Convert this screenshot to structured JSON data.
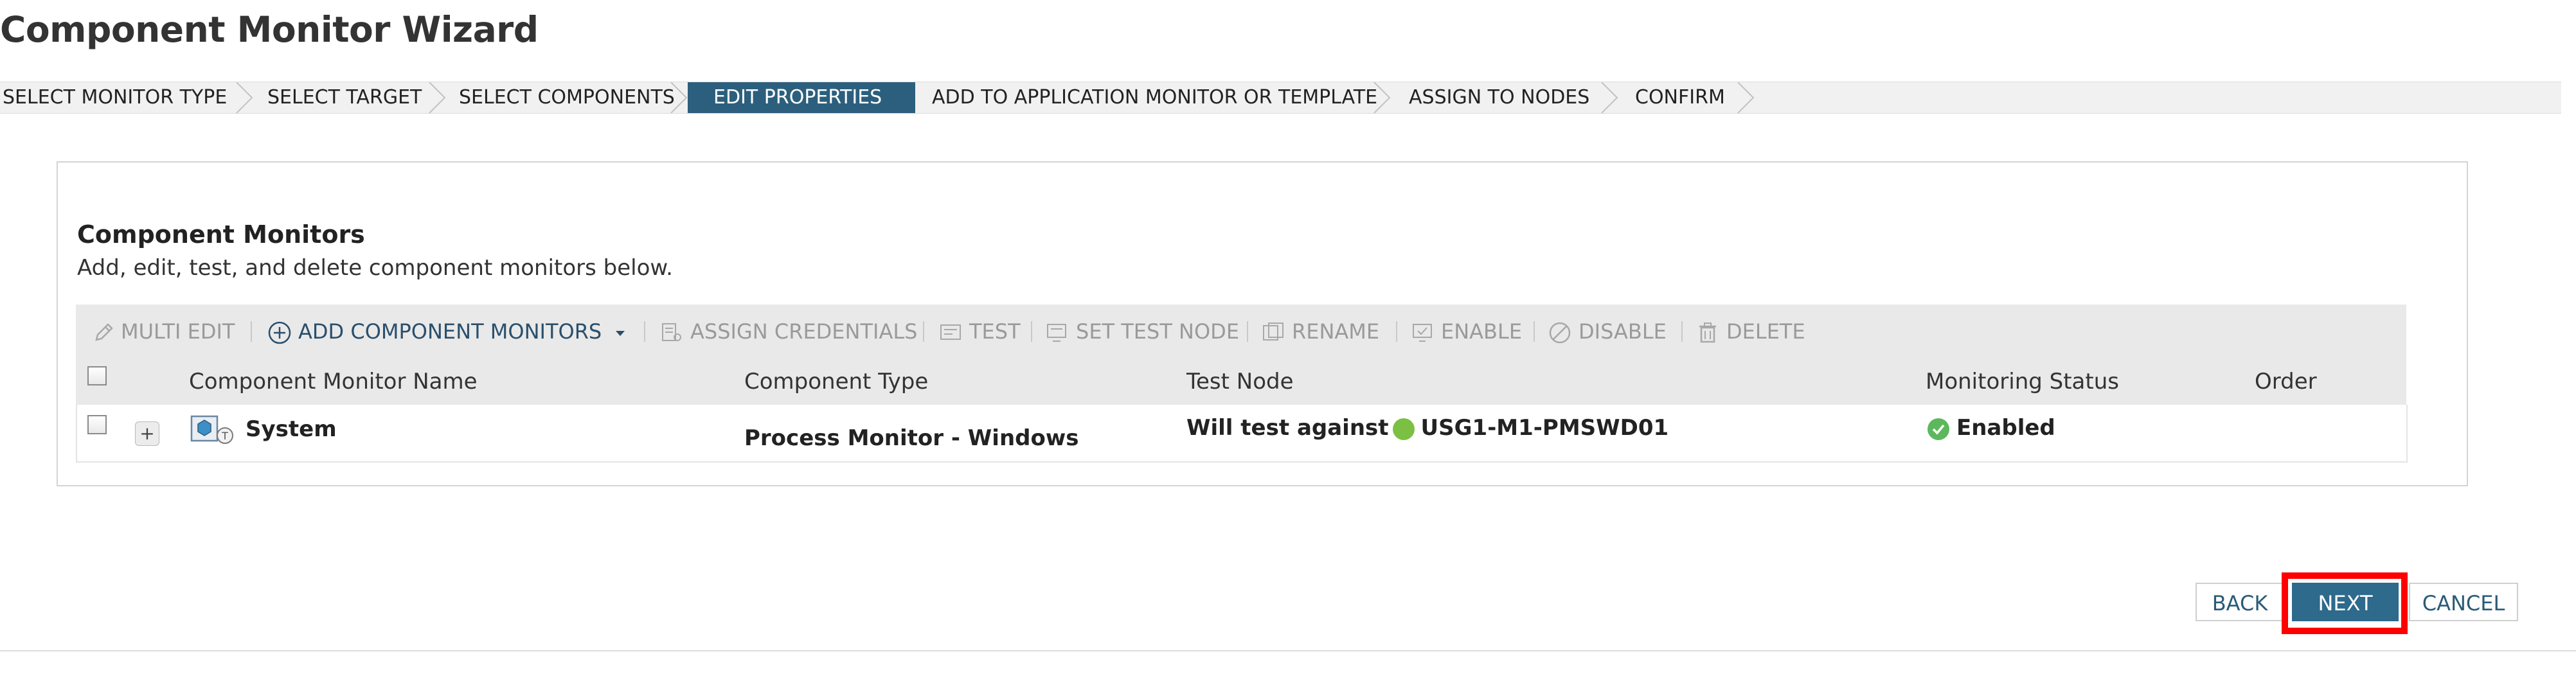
{
  "page": {
    "title": "Component Monitor Wizard"
  },
  "steps": [
    {
      "label": "SELECT MONITOR TYPE",
      "active": false
    },
    {
      "label": "SELECT TARGET",
      "active": false
    },
    {
      "label": "SELECT COMPONENTS",
      "active": false
    },
    {
      "label": "EDIT PROPERTIES",
      "active": true
    },
    {
      "label": "ADD TO APPLICATION MONITOR OR TEMPLATE",
      "active": false
    },
    {
      "label": "ASSIGN TO NODES",
      "active": false
    },
    {
      "label": "CONFIRM",
      "active": false
    }
  ],
  "section": {
    "title": "Component Monitors",
    "description": "Add, edit, test, and delete component monitors below."
  },
  "toolbar": {
    "multi_edit": "MULTI EDIT",
    "add_component_monitors": "ADD COMPONENT MONITORS",
    "assign_credentials": "ASSIGN CREDENTIALS",
    "test": "TEST",
    "set_test_node": "SET TEST NODE",
    "rename": "RENAME",
    "enable": "ENABLE",
    "disable": "DISABLE",
    "delete": "DELETE"
  },
  "table": {
    "columns": {
      "name": "Component Monitor Name",
      "type": "Component Type",
      "test_node": "Test Node",
      "status": "Monitoring Status",
      "order": "Order"
    },
    "rows": [
      {
        "name": "System",
        "type": "Process Monitor - Windows",
        "test_prefix": "Will test against",
        "test_node": "USG1-M1-PMSWD01",
        "status": "Enabled"
      }
    ]
  },
  "buttons": {
    "back": "BACK",
    "next": "NEXT",
    "cancel": "CANCEL"
  },
  "colors": {
    "active_step": "#2c5f7d",
    "primary_button": "#2d6a8c",
    "status_green": "#7bc043",
    "highlight": "#ff0000"
  }
}
